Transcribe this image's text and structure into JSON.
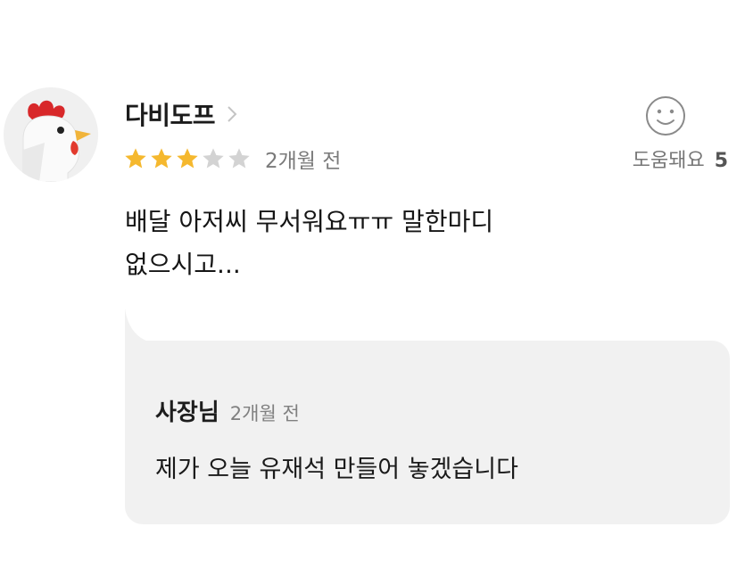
{
  "review": {
    "reviewer_name": "다비도프",
    "avatar_icon": "chicken-avatar-icon",
    "rating": 3,
    "rating_max": 5,
    "star_color_filled": "#f5b82e",
    "star_color_empty": "#d3d3d3",
    "date": "2개월 전",
    "helpful_label": "도움돼요",
    "helpful_count": "5",
    "text": "배달 아저씨 무서워요ㅠㅠ 말한마디\n없으시고..."
  },
  "reply": {
    "author": "사장님",
    "date": "2개월 전",
    "text": "제가 오늘 유재석 만들어 놓겠습니다",
    "background": "#f1f1f1"
  }
}
